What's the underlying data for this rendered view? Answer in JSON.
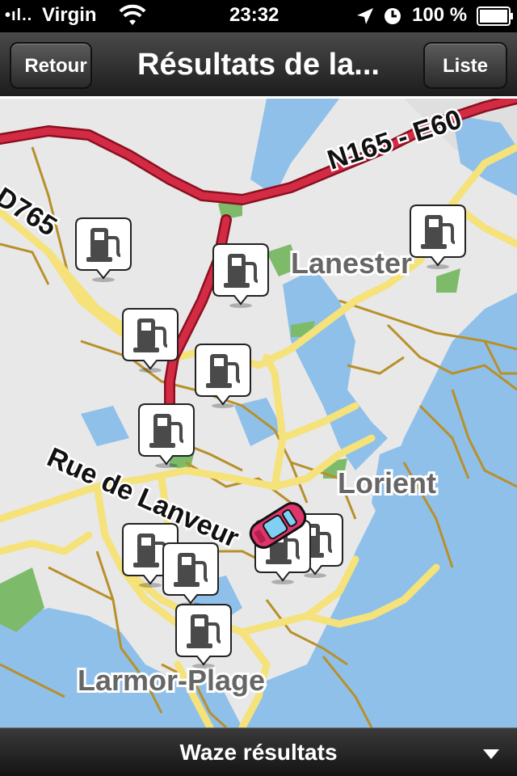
{
  "status_bar": {
    "signal": "•ıl..",
    "carrier": "Virgin",
    "time": "23:32",
    "battery": "100 %"
  },
  "nav": {
    "back_label": "Retour",
    "title": "Résultats de la...",
    "list_label": "Liste"
  },
  "map": {
    "roads": [
      "N165 - E60",
      "D765",
      "Rue de Lanveur"
    ],
    "places": [
      "Lanester",
      "Lorient",
      "Larmor-Plage"
    ],
    "marker_icon": "gas-pump-icon",
    "vehicle_icon": "car-icon"
  },
  "bottom": {
    "label": "Waze résultats"
  }
}
